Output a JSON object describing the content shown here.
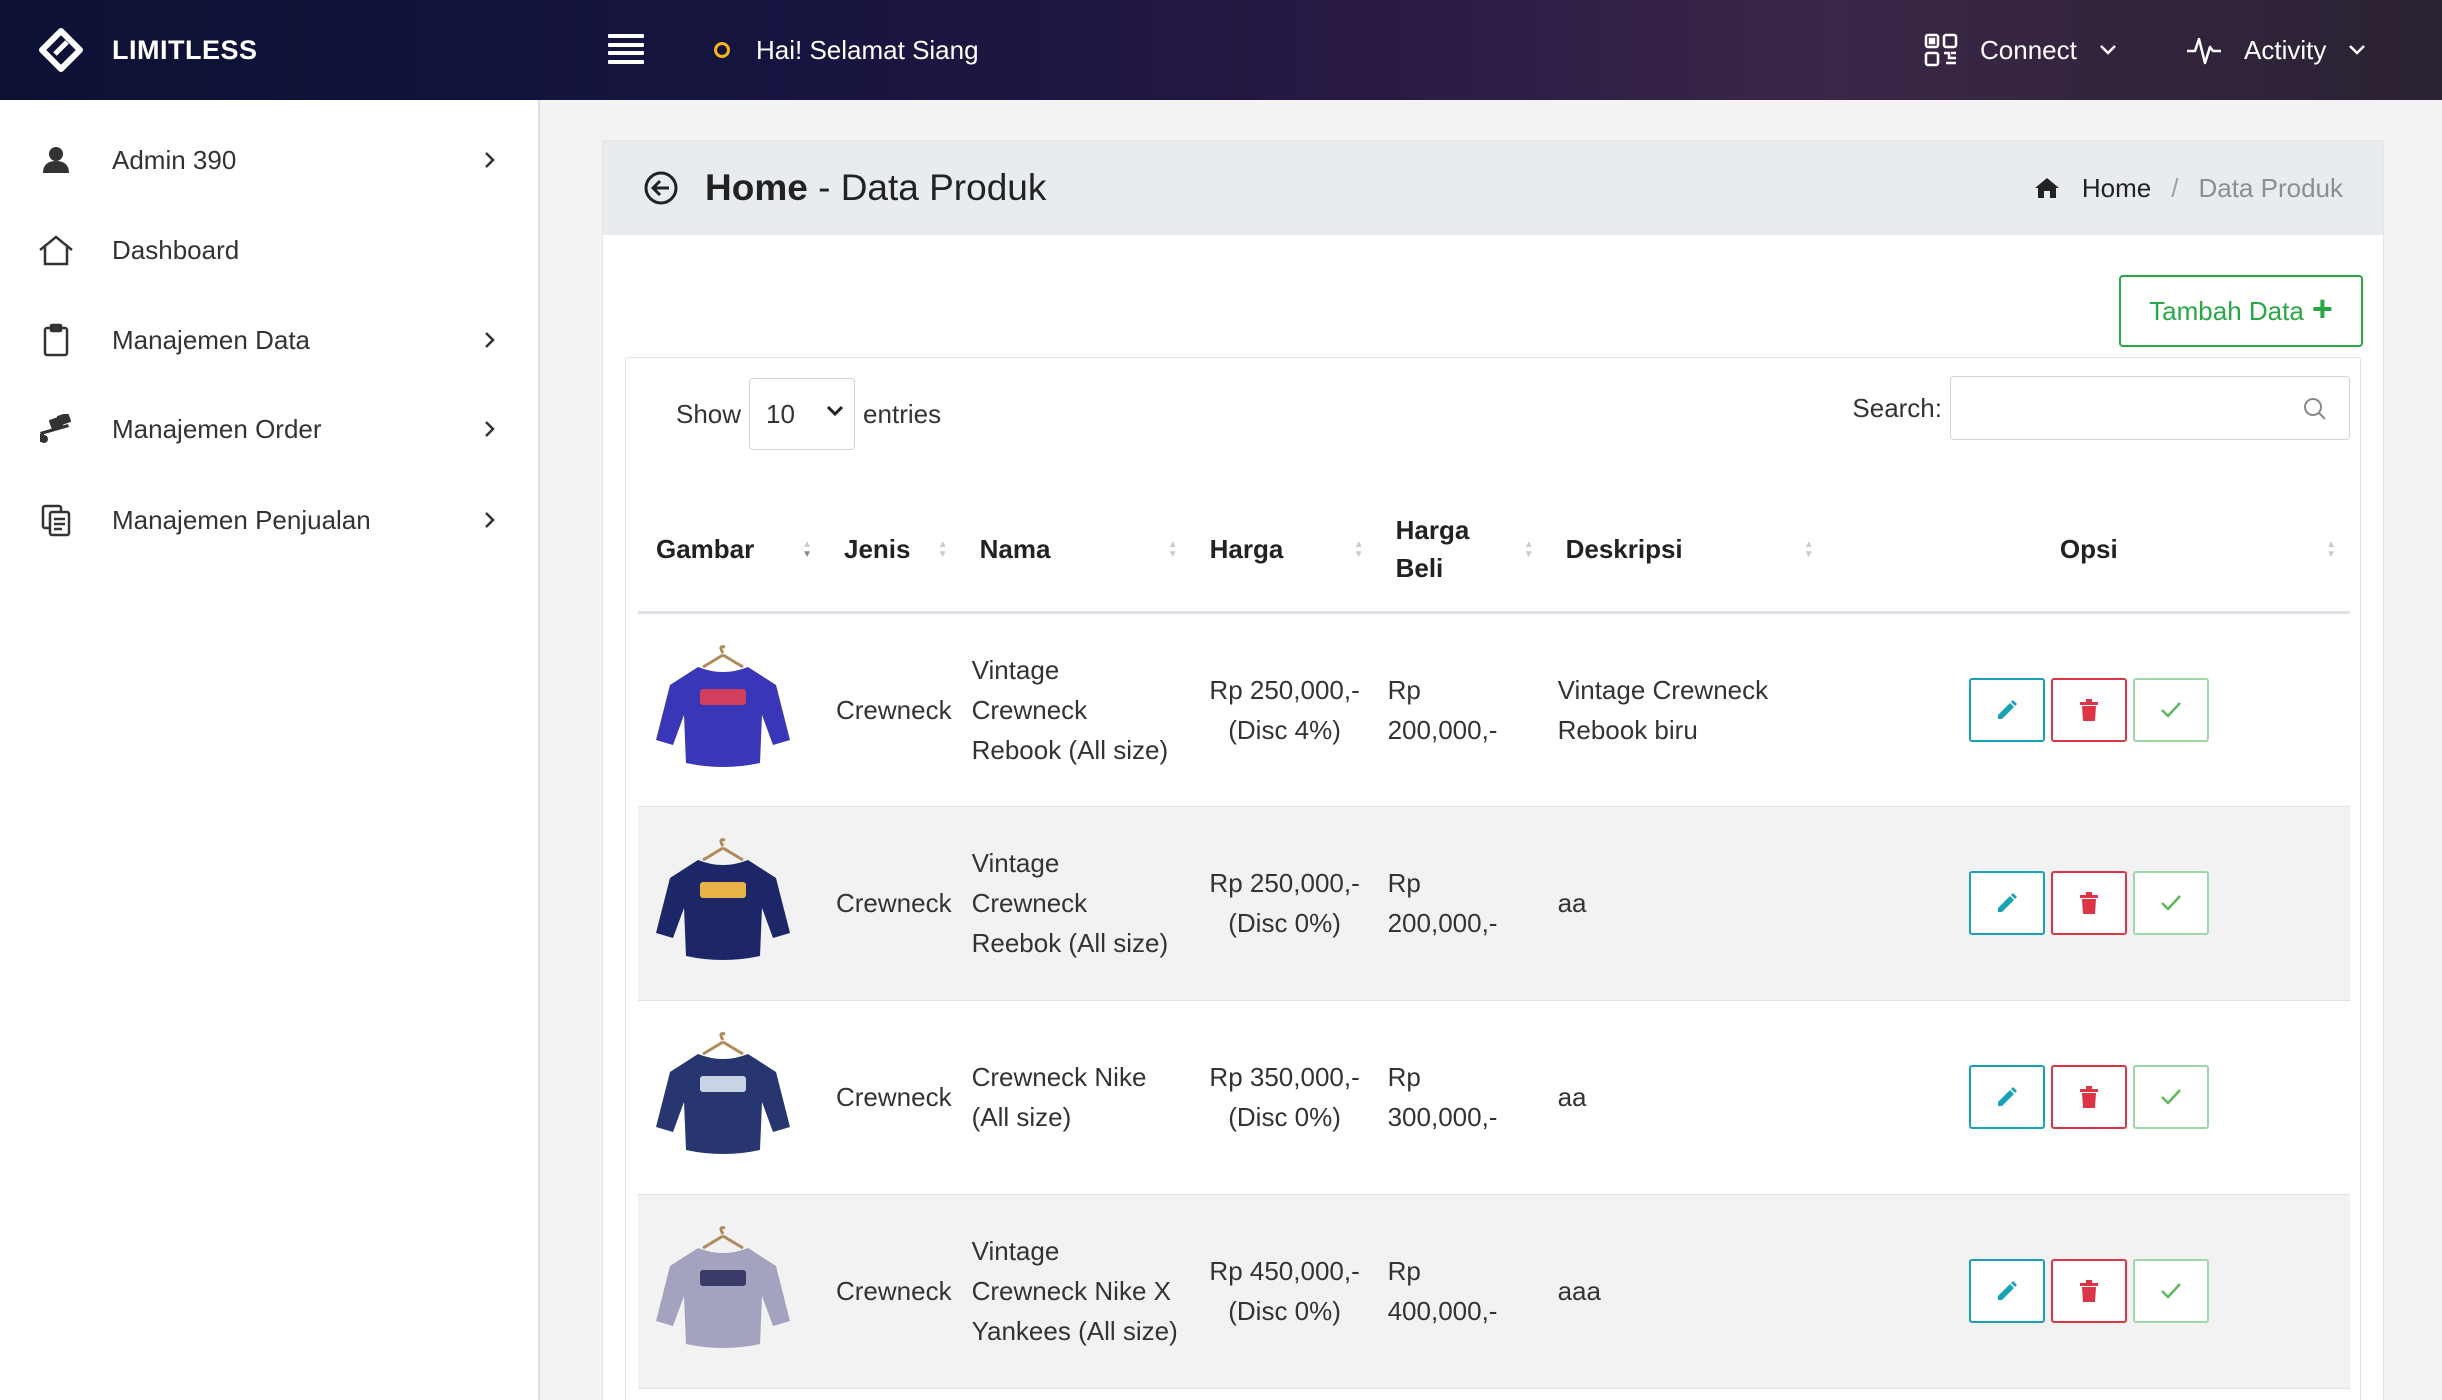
{
  "topbar": {
    "brand": "LIMITLESS",
    "greeting": "Hai! Selamat Siang",
    "connect_label": "Connect",
    "activity_label": "Activity"
  },
  "sidebar": {
    "items": [
      {
        "label": "Admin 390",
        "icon": "user-icon"
      },
      {
        "label": "Dashboard",
        "icon": "home-icon"
      },
      {
        "label": "Manajemen Data",
        "icon": "clipboard-icon"
      },
      {
        "label": "Manajemen Order",
        "icon": "dolly-icon"
      },
      {
        "label": "Manajemen Penjualan",
        "icon": "copy-icon"
      }
    ]
  },
  "header": {
    "title_bold": "Home",
    "title_rest": " - Data Produk",
    "breadcrumb_home": "Home",
    "breadcrumb_sep": "/",
    "breadcrumb_current": "Data Produk"
  },
  "add_button": "Tambah Data",
  "table_controls": {
    "show_label": "Show",
    "entries_value": "10",
    "entries_label": "entries",
    "search_label": "Search:",
    "search_value": ""
  },
  "columns": [
    "Gambar",
    "Jenis",
    "Nama",
    "Harga",
    "Harga Beli",
    "Deskripsi",
    "Opsi"
  ],
  "rows": [
    {
      "jenis": "Crewneck",
      "nama": "Vintage Crewneck Rebook (All size)",
      "harga": "Rp 250,000,-",
      "disc": "(Disc 4%)",
      "harga_beli": "Rp 200,000,-",
      "deskripsi": "Vintage Crewneck Rebook biru",
      "shirt_color": "#3a36b8",
      "print_color": "#d23f5c"
    },
    {
      "jenis": "Crewneck",
      "nama": "Vintage Crewneck Reebok (All size)",
      "harga": "Rp 250,000,-",
      "disc": "(Disc 0%)",
      "harga_beli": "Rp 200,000,-",
      "deskripsi": "aa",
      "shirt_color": "#1d2767",
      "print_color": "#e8b44a"
    },
    {
      "jenis": "Crewneck",
      "nama": "Crewneck Nike (All size)",
      "harga": "Rp 350,000,-",
      "disc": "(Disc 0%)",
      "harga_beli": "Rp 300,000,-",
      "deskripsi": "aa",
      "shirt_color": "#27366e",
      "print_color": "#c9d3e6"
    },
    {
      "jenis": "Crewneck",
      "nama": "Vintage Crewneck Nike X Yankees (All size)",
      "harga": "Rp 450,000,-",
      "disc": "(Disc 0%)",
      "harga_beli": "Rp 400,000,-",
      "deskripsi": "aaa",
      "shirt_color": "#a4a3bf",
      "print_color": "#3b3b6a"
    }
  ]
}
